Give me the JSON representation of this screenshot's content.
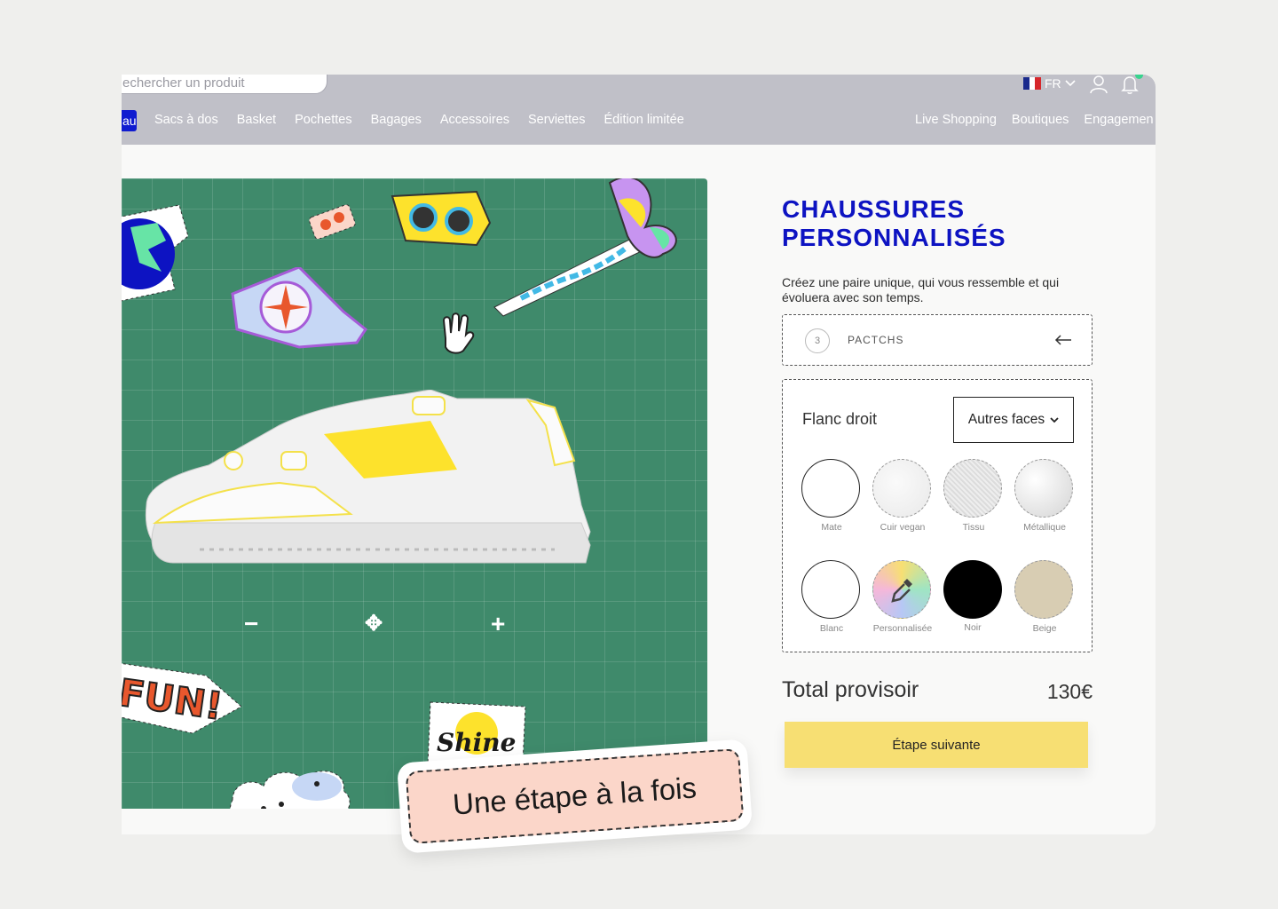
{
  "header": {
    "search_placeholder": "echercher un produit",
    "language": "FR",
    "nav_active": "au",
    "nav_left": [
      "Sacs à dos",
      "Basket",
      "Pochettes",
      "Bagages",
      "Accessoires",
      "Serviettes",
      "Édition limitée"
    ],
    "nav_right": [
      "Live Shopping",
      "Boutiques",
      "Engagemen"
    ]
  },
  "canvas": {
    "controls": {
      "zoom_out": "−",
      "move": "✥",
      "zoom_in": "+"
    },
    "stickers": [
      "globe-sticker",
      "flowers-sticker",
      "glasses-sticker",
      "butterfly-sticker",
      "compass-sticker",
      "fun-sticker",
      "shine-sticker",
      "clouds-sticker"
    ],
    "sticker_text": {
      "fun": "FUN!",
      "shine": "Shine"
    }
  },
  "banner": {
    "text": "Une étape à la fois"
  },
  "panel": {
    "title_line1": "CHAUSSURES",
    "title_line2": "PERSONNALISÉS",
    "description": "Créez une paire unique, qui vous ressemble et qui évoluera avec son temps.",
    "step": {
      "number": "3",
      "label": "PACTCHS"
    },
    "face": {
      "label": "Flanc droit",
      "select_label": "Autres faces"
    },
    "materials": [
      "Mate",
      "Cuir vegan",
      "Tissu",
      "Métallique"
    ],
    "colors": [
      "Blanc",
      "Personnalisée",
      "Noir",
      "Beige"
    ],
    "total_label": "Total provisoir",
    "total_value": "130€",
    "next_label": "Étape suivante"
  },
  "colors": {
    "accent_blue": "#0d13c2",
    "canvas_green": "#3f8a6b",
    "button_yellow": "#f7df73",
    "banner_pink": "#fbd6c9",
    "shoe_yellow": "#fde22c"
  }
}
